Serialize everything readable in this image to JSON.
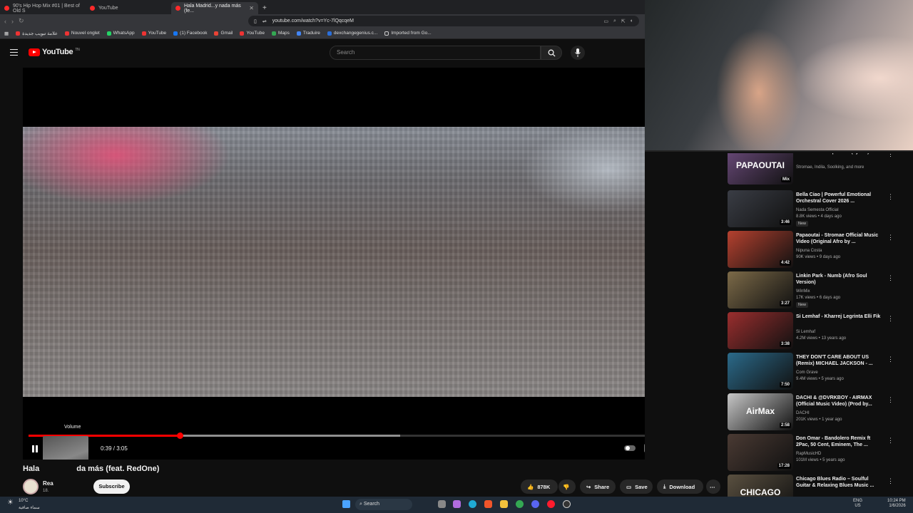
{
  "browser": {
    "tabs": [
      {
        "label": "90's Hip Hop Mix #01 | Best of Old S"
      },
      {
        "label": "YouTube"
      },
      {
        "label": "Hala Madrid...y nada más (fe..."
      }
    ],
    "url": "youtube.com/watch?v=Yc-7lQqcqeM",
    "bookmarks": [
      "علامة تبويب جديدة",
      "Nouvel onglet",
      "WhatsApp",
      "YouTube",
      "(1) Facebook",
      "Gmail",
      "YouTube",
      "Maps",
      "Traduire",
      "dexchangegenius.c...",
      "Imported from Go..."
    ]
  },
  "youtube": {
    "logo": "YouTube",
    "logo_sup": "TN",
    "search_placeholder": "Search"
  },
  "player": {
    "volume_tooltip": "Volume",
    "time": "0:39 / 3:05",
    "progress_fraction": 0.22,
    "buffer_fraction": 0.54,
    "overlay_text": "x9"
  },
  "video": {
    "title_left": "Hala",
    "title_right": "da más (feat. RedOne)",
    "channel": "Rea",
    "subs": "18.",
    "subscribe": "Subscribe",
    "likes": "878K",
    "share": "Share",
    "save": "Save",
    "download": "Download"
  },
  "recommendations": [
    {
      "title": "... Stromae - Papaoutai (Lyrics)",
      "meta1": "Stromae, Indila, Soolking, and more",
      "meta2": "",
      "duration": "Mix",
      "thumb_text": "PAPAOUTAI",
      "color": "#6a4a7a",
      "new": false
    },
    {
      "title": "Bella Ciao | Powerful Emotional Orchestral Cover 2026 ...",
      "meta1": "Nada Semesta Official",
      "meta2": "8.8K views • 4 days ago",
      "duration": "3:46",
      "thumb_text": "",
      "color": "#3a3d45",
      "new": true
    },
    {
      "title": "Papaoutai - Stromae Official Music Video  (Original Afro by ...",
      "meta1": "Nipuna Costa",
      "meta2": "90K views • 9 days ago",
      "duration": "4:42",
      "thumb_text": "",
      "color": "#b5412f",
      "new": false
    },
    {
      "title": "Linkin Park - Numb (Afro Soul Version)",
      "meta1": "WinMix",
      "meta2": "17K views • 6 days ago",
      "duration": "3:27",
      "thumb_text": "",
      "color": "#7c6a48",
      "new": true
    },
    {
      "title": "Si Lemhaf - Kharrej Legrinta Elli Fik",
      "meta1": "Si Lemhaf",
      "meta2": "4.2M views • 13 years ago",
      "duration": "3:38",
      "thumb_text": "",
      "color": "#9a2e2e",
      "new": false
    },
    {
      "title": "THEY DON'T CARE ABOUT US (Remix) MICHAEL JACKSON - ...",
      "meta1": "Com Grave",
      "meta2": "9.4M views • 5 years ago",
      "duration": "7:50",
      "thumb_text": "",
      "color": "#2b6a8a",
      "new": false
    },
    {
      "title": "DACHI & @DVRKBOY - AIRMAX (Official Music Video) (Prod by...",
      "meta1": "DACHI",
      "meta2": "201K views • 1 year ago",
      "duration": "2:58",
      "thumb_text": "AirMax",
      "color": "#c7c7c7",
      "new": false
    },
    {
      "title": "Don Omar - Bandolero Remix ft 2Pac, 50 Cent, Eminem, The ...",
      "meta1": "RapMusicHD",
      "meta2": "101M views • 5 years ago",
      "duration": "17:28",
      "thumb_text": "",
      "color": "#4a3a33",
      "new": false
    },
    {
      "title": "Chicago Blues Radio – Soulful Guitar & Relaxing Blues Music ...",
      "meta1": "",
      "meta2": "",
      "duration": "",
      "thumb_text": "CHICAGO",
      "color": "#5a5040",
      "new": false
    }
  ],
  "taskbar": {
    "weather_temp": "10°C",
    "weather_desc": "سماء صافية",
    "search": "Search",
    "lang1": "ENG",
    "lang2": "US",
    "time": "10:24 PM",
    "date": "1/6/2026"
  }
}
